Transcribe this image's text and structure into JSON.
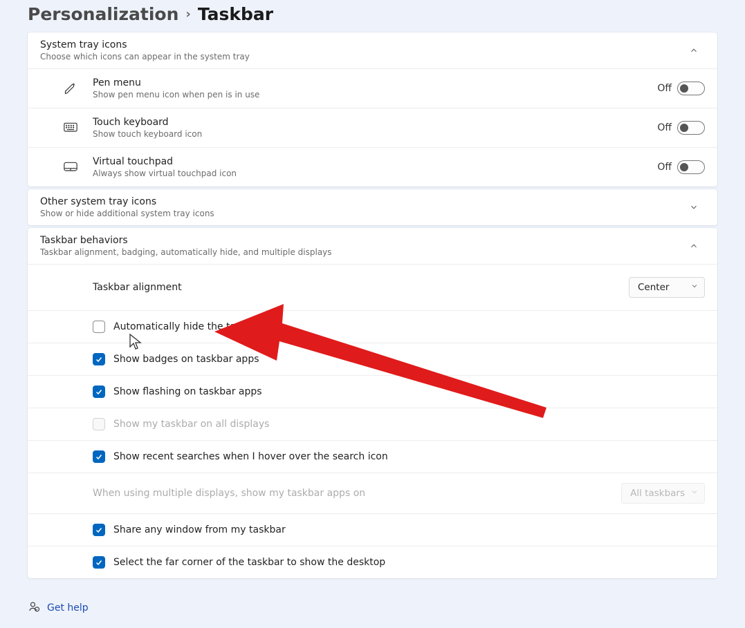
{
  "breadcrumb": {
    "parent": "Personalization",
    "current": "Taskbar"
  },
  "tray": {
    "title": "System tray icons",
    "sub": "Choose which icons can appear in the system tray",
    "items": [
      {
        "title": "Pen menu",
        "sub": "Show pen menu icon when pen is in use",
        "state": "Off"
      },
      {
        "title": "Touch keyboard",
        "sub": "Show touch keyboard icon",
        "state": "Off"
      },
      {
        "title": "Virtual touchpad",
        "sub": "Always show virtual touchpad icon",
        "state": "Off"
      }
    ]
  },
  "other": {
    "title": "Other system tray icons",
    "sub": "Show or hide additional system tray icons"
  },
  "behaviors": {
    "title": "Taskbar behaviors",
    "sub": "Taskbar alignment, badging, automatically hide, and multiple displays",
    "alignment": {
      "label": "Taskbar alignment",
      "value": "Center"
    },
    "checks": [
      {
        "label": "Automatically hide the taskbar",
        "checked": false,
        "disabled": false
      },
      {
        "label": "Show badges on taskbar apps",
        "checked": true,
        "disabled": false
      },
      {
        "label": "Show flashing on taskbar apps",
        "checked": true,
        "disabled": false
      },
      {
        "label": "Show my taskbar on all displays",
        "checked": false,
        "disabled": true
      },
      {
        "label": "Show recent searches when I hover over the search icon",
        "checked": true,
        "disabled": false
      }
    ],
    "multi": {
      "label": "When using multiple displays, show my taskbar apps on",
      "value": "All taskbars",
      "disabled": true
    },
    "checks2": [
      {
        "label": "Share any window from my taskbar",
        "checked": true,
        "disabled": false
      },
      {
        "label": "Select the far corner of the taskbar to show the desktop",
        "checked": true,
        "disabled": false
      }
    ]
  },
  "help": {
    "label": "Get help"
  }
}
